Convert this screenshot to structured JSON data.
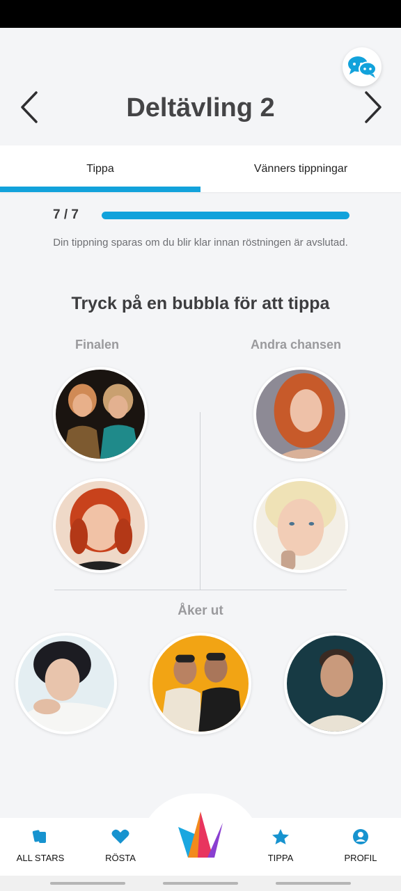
{
  "header": {
    "title": "Deltävling 2"
  },
  "tabs": [
    {
      "label": "Tippa",
      "active": true
    },
    {
      "label": "Vänners tippningar",
      "active": false
    }
  ],
  "progress": {
    "label": "7 / 7",
    "completed": 7,
    "total": 7,
    "fraction": 1.0
  },
  "info_text": "Din tippning sparas om du blir klar innan röstningen är avslutad.",
  "section_title": "Tryck på en bubbla för att tippa",
  "columns": {
    "finalen": "Finalen",
    "andra_chansen": "Andra chansen",
    "aker_ut": "Åker ut"
  },
  "bottom_nav": [
    {
      "label": "ALL STARS",
      "icon": "cards-icon"
    },
    {
      "label": "RÖSTA",
      "icon": "heart-icon"
    },
    {
      "label": "TIPPA",
      "icon": "star-icon"
    },
    {
      "label": "PROFIL",
      "icon": "profile-icon"
    }
  ],
  "colors": {
    "accent": "#12a2db",
    "background": "#f4f5f7"
  }
}
